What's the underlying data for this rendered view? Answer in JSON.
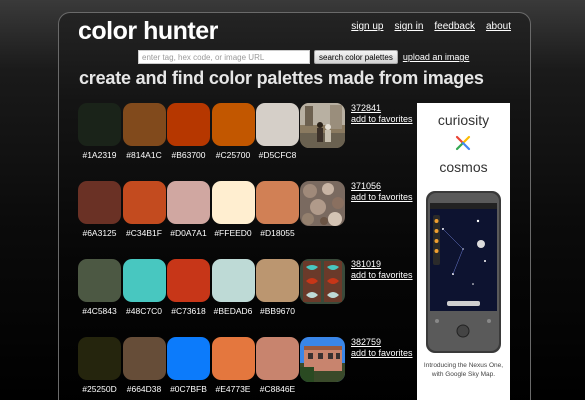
{
  "app": {
    "logo": "color hunter",
    "nav": [
      "sign up",
      "sign in",
      "feedback",
      "about"
    ]
  },
  "search": {
    "placeholder": "enter tag, hex code, or image URL",
    "button_label": "search color palettes",
    "upload_label": "upload an image"
  },
  "headline": "create and find color palettes made from images",
  "palettes": [
    {
      "id": "372841",
      "favorite_label": "add to favorites",
      "colors": [
        "#1A2319",
        "#814A1C",
        "#B63700",
        "#C25700",
        "#D5CFC8"
      ],
      "thumb_icon": "street-photo-icon"
    },
    {
      "id": "371056",
      "favorite_label": "add to favorites",
      "colors": [
        "#6A3125",
        "#C34B1F",
        "#D0A7A1",
        "#FFEED0",
        "#D18055"
      ],
      "thumb_icon": "pebbles-photo-icon"
    },
    {
      "id": "381019",
      "favorite_label": "add to favorites",
      "colors": [
        "#4C5843",
        "#48C7C0",
        "#C73618",
        "#BEDAD6",
        "#BB9670"
      ],
      "thumb_icon": "ornate-door-photo-icon"
    },
    {
      "id": "382759",
      "favorite_label": "add to favorites",
      "colors": [
        "#25250D",
        "#664D38",
        "#0C7BFB",
        "#E4773E",
        "#C8846E"
      ],
      "thumb_icon": "building-photo-icon"
    }
  ],
  "ad": {
    "word1": "curiosity",
    "word2": "cosmos",
    "caption_line1": "Introducing the Nexus One,",
    "caption_line2": "with Google Sky Map."
  }
}
